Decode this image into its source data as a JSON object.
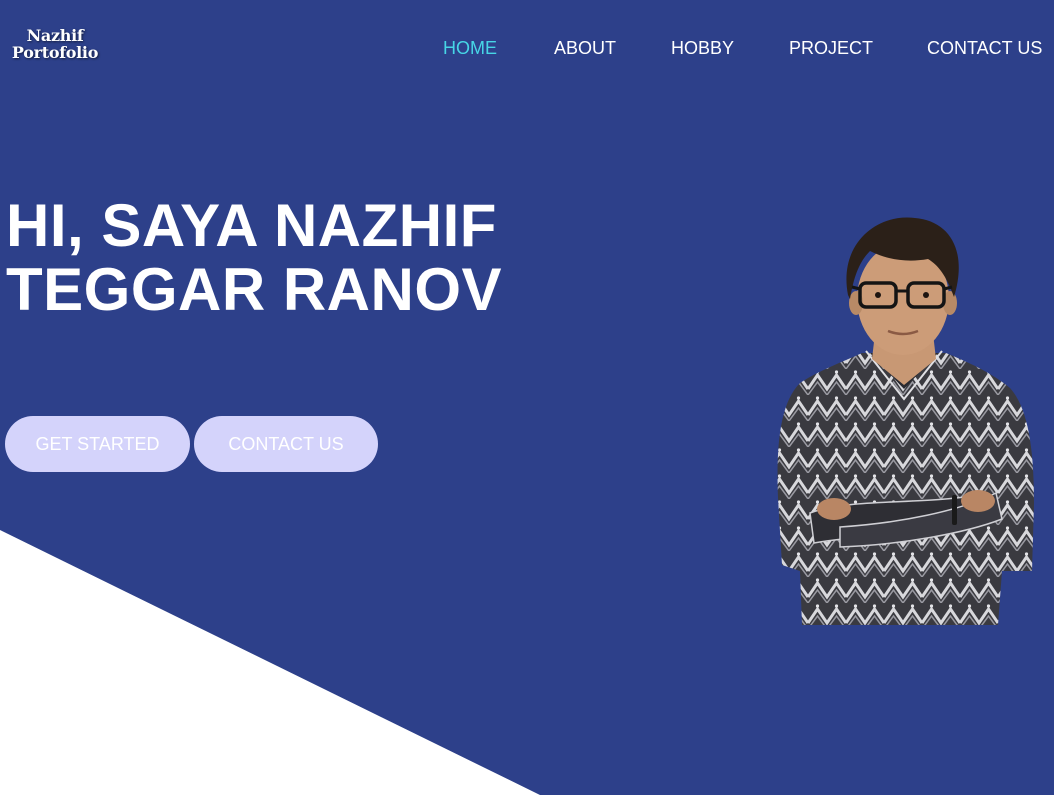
{
  "brand": {
    "line1": "Nazhif",
    "line2": "Portofolio"
  },
  "nav": {
    "items": [
      {
        "label": "HOME",
        "active": true
      },
      {
        "label": "ABOUT"
      },
      {
        "label": "HOBBY"
      },
      {
        "label": "PROJECT"
      },
      {
        "label": "CONTACT US"
      }
    ]
  },
  "hero": {
    "title_line1": "HI, SAYA NAZHIF",
    "title_line2": "TEGGAR RANOV",
    "primary_button": "GET STARTED",
    "secondary_button": "CONTACT US"
  },
  "colors": {
    "background": "#2d408a",
    "nav_active": "#47d6e6",
    "button_bg": "#d4d3fb",
    "shape": "#ffffff"
  }
}
